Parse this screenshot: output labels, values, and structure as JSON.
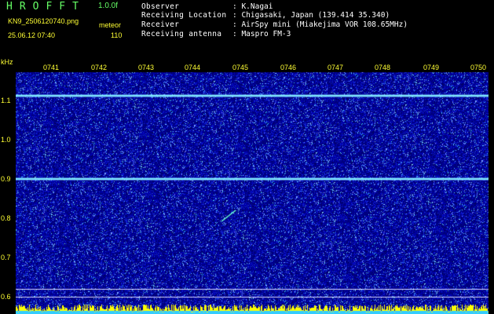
{
  "header": {
    "app_title": "HROFFT",
    "version": "1.0.0f",
    "filename": "KN9_2506120740.png",
    "mode": "meteor",
    "datetime": "25.06.12 07:40",
    "count": "110"
  },
  "metadata": [
    {
      "key": "Observer",
      "value": ": K.Nagai"
    },
    {
      "key": "Receiving Location",
      "value": ": Chigasaki, Japan (139.414 35.340)"
    },
    {
      "key": "Receiver",
      "value": ": AirSpy mini (Miakejima VOR 108.65MHz)"
    },
    {
      "key": "Receiving antenna",
      "value": ": Maspro FM-3"
    }
  ],
  "axis": {
    "unit": "kHz",
    "time_ticks": [
      "0741",
      "0742",
      "0743",
      "0744",
      "0745",
      "0746",
      "0747",
      "0748",
      "0749",
      "0750"
    ],
    "freq_ticks": [
      "1.1",
      "1.0",
      "0.9",
      "0.8",
      "0.7",
      "0.6"
    ]
  },
  "colors": {
    "background": "#000000",
    "label": "#ffff33",
    "title": "#66ff66",
    "noise_base": "#10107a",
    "line_cyan": "#7fe8ff"
  },
  "chart_data": {
    "type": "heatmap",
    "xlabel": "",
    "ylabel": "kHz",
    "x_ticks": [
      "0741",
      "0742",
      "0743",
      "0744",
      "0745",
      "0746",
      "0747",
      "0748",
      "0749",
      "0750"
    ],
    "y_ticks": [
      1.1,
      1.0,
      0.9,
      0.8,
      0.7,
      0.6
    ],
    "ylim": [
      0.58,
      1.15
    ],
    "continuous_carriers_khz": [
      1.112,
      0.9
    ],
    "meteor_echo": {
      "time": "0744",
      "freq_khz": [
        0.8,
        0.82
      ]
    }
  }
}
